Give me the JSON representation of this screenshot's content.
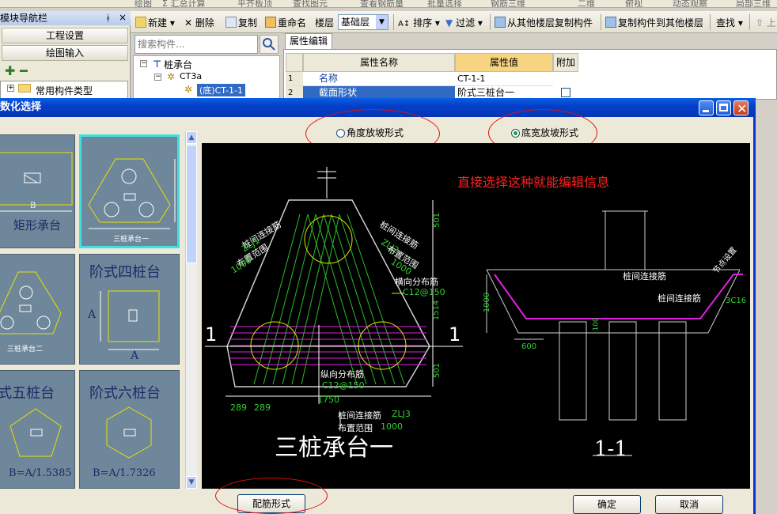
{
  "topbar": {
    "items": [
      "绘图",
      "Σ 汇总计算",
      "平齐板顶",
      "查找图元",
      "查看钢筋量",
      "批量选择",
      "钢筋三维",
      "二维",
      "俯视",
      "动态观察",
      "局部三维"
    ]
  },
  "nav": {
    "title": "模块导航栏",
    "pin": "ᅟ",
    "close": "×",
    "btn_settings": "工程设置",
    "btn_draw": "绘图输入",
    "tree_common": "常用构件类型"
  },
  "toolbar": {
    "new": "新建",
    "delete": "删除",
    "copy": "复制",
    "rename": "重命名",
    "floor_label": "楼层",
    "floor_value": "基础层",
    "sort": "排序",
    "filter": "过滤",
    "copy_from": "从其他楼层复制构件",
    "copy_to": "复制构件到其他楼层",
    "find": "查找",
    "up": "上"
  },
  "search": {
    "placeholder": "搜索构件..."
  },
  "tree": {
    "root": "桩承台",
    "child": "CT3a",
    "leaf": "(底)CT-1-1"
  },
  "props": {
    "tab": "属性编辑",
    "col_name": "属性名称",
    "col_value": "属性值",
    "col_extra": "附加",
    "rows": [
      {
        "no": "1",
        "name": "名称",
        "value": "CT-1-1"
      },
      {
        "no": "2",
        "name": "截面形状",
        "value": "阶式三桩台一"
      }
    ]
  },
  "dialog": {
    "title": "数化选择",
    "option_angle": "角度放坡形式",
    "option_width": "底宽放坡形式",
    "btn_rebar": "配筋形式",
    "btn_ok": "确定",
    "btn_cancel": "取消"
  },
  "gallery": {
    "cards": [
      {
        "title": "矩形承台",
        "sub": "B"
      },
      {
        "title": "",
        "sub": "三桩承台一"
      },
      {
        "title": "",
        "sub": "三桩承台二"
      },
      {
        "title": "阶式四桩台",
        "sub": "A"
      },
      {
        "title": "式五桩台",
        "sub": "B=A/1.5385"
      },
      {
        "title": "阶式六桩台",
        "sub": "B=A/1.7326"
      }
    ]
  },
  "drawing": {
    "note": "直接选择这种就能编辑信息",
    "title_left": "三桩承台一",
    "title_right": "1-1",
    "labels": {
      "zlj1": "桩间连接筋",
      "zlj1_code": "ZLJ1",
      "range": "布置范围",
      "range_val": "1000",
      "zlj2": "桩间连接筋",
      "zlj2_code": "ZLJ2",
      "horiz": "横向分布筋",
      "horiz_code": "C12@150",
      "vert": "纵向分布筋",
      "vert_code": "C12@150",
      "zlj3": "桩间连接筋",
      "zlj3_code": "ZLJ3",
      "dim501a": "501",
      "dim1514": "1514",
      "dim501b": "501",
      "dim289a": "289",
      "dim289b": "289",
      "dim1750": "1750",
      "sec1": "1",
      "rz1": "桩间连接筋",
      "rz2": "桩间连接筋",
      "rz3": "节点设置",
      "r1000": "1000",
      "r600": "600",
      "r100": "100",
      "r3c16": "3C16"
    }
  },
  "colors": {
    "accent_blue": "#0a5fe6",
    "drawing_green": "#2fd12f",
    "drawing_magenta": "#e020e0",
    "drawing_yellow": "#e8e000",
    "drawing_red": "#ff2020",
    "selected_card": "#40e0e0"
  }
}
